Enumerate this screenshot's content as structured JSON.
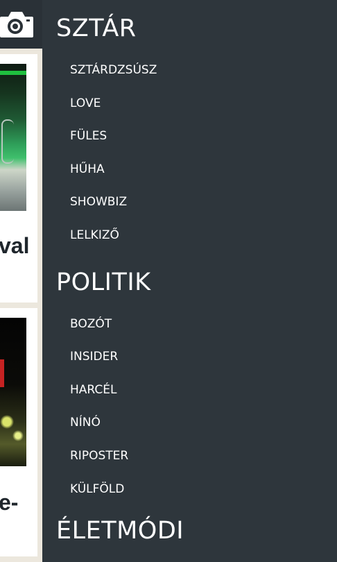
{
  "background": {
    "card_1_text": "val",
    "card_2_text": "e-"
  },
  "drawer": {
    "sections": [
      {
        "title": "SZTÁR",
        "items": [
          "SZTÁRDZSÚSZ",
          "LOVE",
          "FÜLES",
          "HŰHA",
          "SHOWBIZ",
          "LELKIZŐ"
        ]
      },
      {
        "title": "POLITIK",
        "items": [
          "BOZÓT",
          "INSIDER",
          "HARCÉL",
          "NÍNÓ",
          "RIPOSTER",
          "KÜLFÖLD"
        ]
      },
      {
        "title": "ÉLETMÓDI",
        "items": []
      }
    ]
  },
  "colors": {
    "drawer_bg": "#2e363c",
    "header_bg": "#2a3137",
    "page_bg": "#ece7dd",
    "text": "#ffffff"
  },
  "icons": {
    "camera": "camera-icon"
  }
}
